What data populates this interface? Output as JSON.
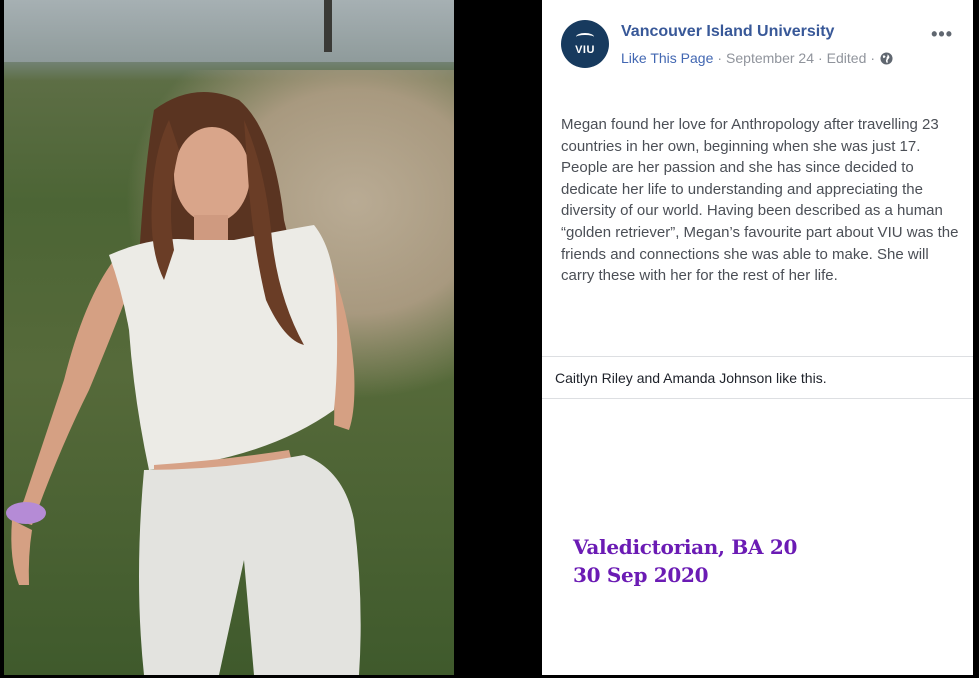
{
  "post": {
    "page_name": "Vancouver Island University",
    "avatar_text": "VIU",
    "like_link": "Like This Page",
    "date": "September 24",
    "edited": "Edited",
    "separator": "·",
    "options": "•••",
    "body": "Megan found her love for Anthropology after travelling 23 countries in her own, beginning when she was just 17. People are her passion and she has since decided to dedicate her life to understanding and appreciating the diversity of our world. Having been described as a human “golden retriever”, Megan’s favourite part about VIU was the friends and connections she was able to make. She will carry these with her for the rest of her life.",
    "likes": "Caitlyn Riley and Amanda Johnson like this."
  },
  "caption": {
    "line1": "Valedictorian, BA 20",
    "line2": "30 Sep 2020"
  },
  "colors": {
    "link": "#385898",
    "caption": "#6b1bb4",
    "avatar_bg": "#173a5e"
  },
  "icons": {
    "globe": "globe-icon",
    "options": "more-options-icon"
  }
}
